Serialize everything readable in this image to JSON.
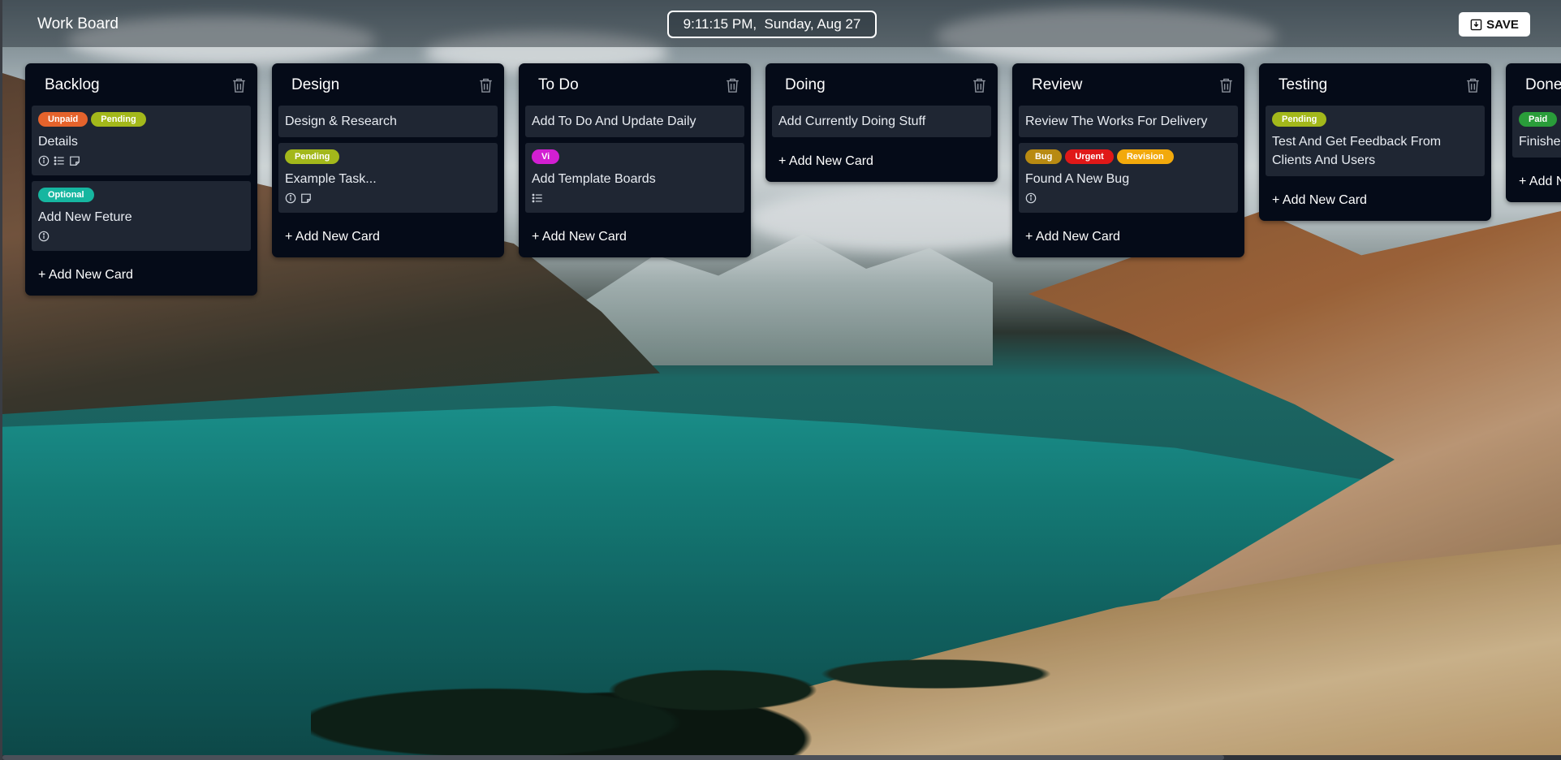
{
  "header": {
    "title": "Work Board",
    "clock": "9:11:15 PM,  Sunday, Aug 27",
    "save_label": "SAVE"
  },
  "lists": [
    {
      "title": "Backlog",
      "cards": [
        {
          "labels": [
            {
              "text": "Unpaid",
              "color": "#e5632c"
            },
            {
              "text": "Pending",
              "color": "#a3b81b"
            }
          ],
          "text": "Details",
          "icons": [
            "info-icon",
            "checklist-icon",
            "note-icon"
          ]
        },
        {
          "labels": [
            {
              "text": "Optional",
              "color": "#16b6a0"
            }
          ],
          "text": "Add New Feture",
          "icons": [
            "info-icon"
          ]
        }
      ],
      "add_label": "+ Add New Card"
    },
    {
      "title": "Design",
      "cards": [
        {
          "labels": [],
          "text": "Design & Research",
          "icons": []
        },
        {
          "labels": [
            {
              "text": "Pending",
              "color": "#a3b81b"
            }
          ],
          "text": "Example Task...",
          "icons": [
            "info-icon",
            "note-icon"
          ]
        }
      ],
      "add_label": "+ Add New Card"
    },
    {
      "title": "To Do",
      "cards": [
        {
          "labels": [],
          "text": "Add To Do And Update Daily",
          "icons": []
        },
        {
          "labels": [
            {
              "text": "Vi",
              "color": "#d21fd2"
            }
          ],
          "text": "Add Template Boards",
          "icons": [
            "checklist-icon"
          ]
        }
      ],
      "add_label": "+ Add New Card"
    },
    {
      "title": "Doing",
      "cards": [
        {
          "labels": [],
          "text": "Add Currently Doing Stuff",
          "icons": []
        }
      ],
      "add_label": "+ Add New Card"
    },
    {
      "title": "Review",
      "cards": [
        {
          "labels": [],
          "text": "Review The Works For Delivery",
          "icons": []
        },
        {
          "labels": [
            {
              "text": "Bug",
              "color": "#b88a12"
            },
            {
              "text": "Urgent",
              "color": "#e01818"
            },
            {
              "text": "Revision",
              "color": "#f2a90c"
            }
          ],
          "text": "Found A New Bug",
          "icons": [
            "info-icon"
          ]
        }
      ],
      "add_label": "+ Add New Card"
    },
    {
      "title": "Testing",
      "cards": [
        {
          "labels": [
            {
              "text": "Pending",
              "color": "#a3b81b"
            }
          ],
          "text": "Test And Get Feedback From Clients And Users",
          "icons": []
        }
      ],
      "add_label": "+ Add New Card"
    },
    {
      "title": "Done",
      "cards": [
        {
          "labels": [
            {
              "text": "Paid",
              "color": "#2a9d3a"
            }
          ],
          "text": "Finished",
          "icons": []
        }
      ],
      "add_label": "+ Add New Card"
    }
  ],
  "colors": {
    "list_bg": "#050b18",
    "card_bg": "#1f2633"
  }
}
